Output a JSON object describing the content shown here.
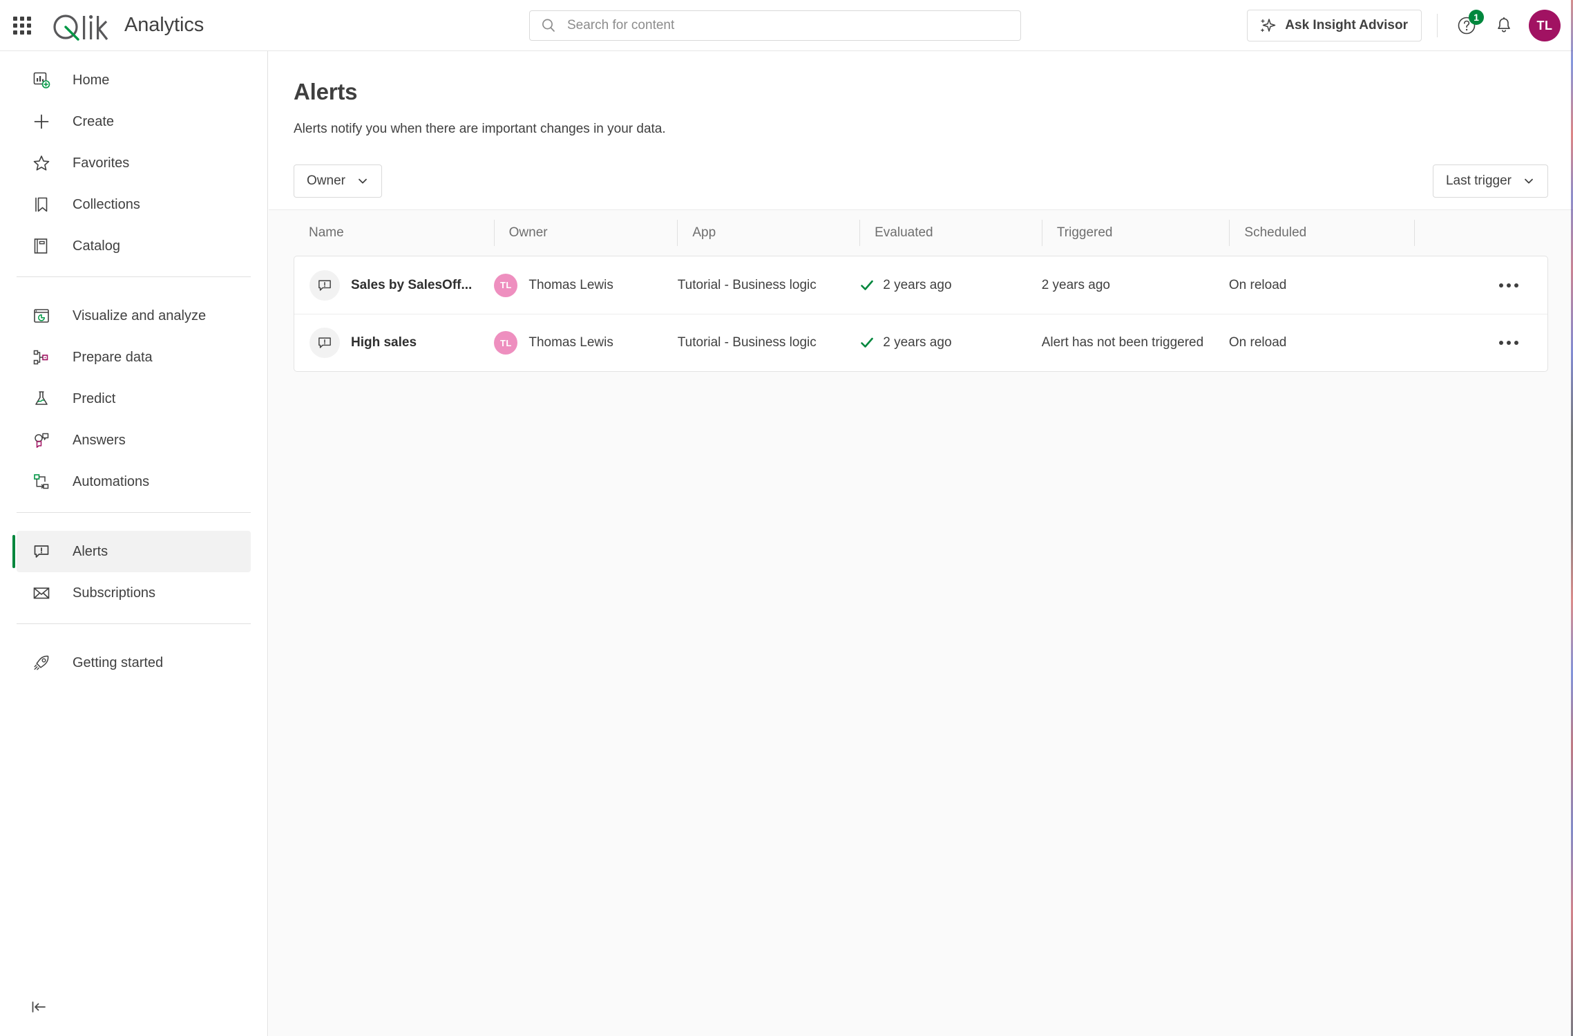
{
  "header": {
    "waffle_label": "app-launcher",
    "brand": "Qlik",
    "brand_title": "Analytics",
    "search_placeholder": "Search for content",
    "search_value": "",
    "insight_advisor": "Ask Insight Advisor",
    "help_badge": "1",
    "avatar_initials": "TL"
  },
  "sidebar": {
    "items": [
      {
        "label": "Home",
        "icon": "home-dashboard-icon",
        "selected": false
      },
      {
        "label": "Create",
        "icon": "plus-icon",
        "selected": false
      },
      {
        "label": "Favorites",
        "icon": "star-icon",
        "selected": false
      },
      {
        "label": "Collections",
        "icon": "bookmark-icon",
        "selected": false
      },
      {
        "label": "Catalog",
        "icon": "book-icon",
        "selected": false
      },
      {
        "label": "Visualize and analyze",
        "icon": "chart-window-icon",
        "selected": false
      },
      {
        "label": "Prepare data",
        "icon": "data-nodes-icon",
        "selected": false
      },
      {
        "label": "Predict",
        "icon": "flask-icon",
        "selected": false
      },
      {
        "label": "Answers",
        "icon": "chat-answers-icon",
        "selected": false
      },
      {
        "label": "Automations",
        "icon": "automation-flow-icon",
        "selected": false
      },
      {
        "label": "Alerts",
        "icon": "alert-bubble-icon",
        "selected": true
      },
      {
        "label": "Subscriptions",
        "icon": "envelope-icon",
        "selected": false
      },
      {
        "label": "Getting started",
        "icon": "rocket-icon",
        "selected": false
      }
    ],
    "collapse_label": "collapse-sidebar"
  },
  "page": {
    "title": "Alerts",
    "description": "Alerts notify you when there are important changes in your data.",
    "owner_filter": "Owner",
    "sort_label": "Last trigger"
  },
  "table": {
    "columns": [
      "Name",
      "Owner",
      "App",
      "Evaluated",
      "Triggered",
      "Scheduled"
    ],
    "rows": [
      {
        "name": "Sales by SalesOff...",
        "owner": "Thomas Lewis",
        "owner_initials": "TL",
        "app": "Tutorial - Business logic",
        "evaluated": "2 years ago",
        "evaluated_ok": true,
        "triggered": "2 years ago",
        "scheduled": "On reload"
      },
      {
        "name": "High sales",
        "owner": "Thomas Lewis",
        "owner_initials": "TL",
        "app": "Tutorial - Business logic",
        "evaluated": "2 years ago",
        "evaluated_ok": true,
        "triggered": "Alert has not been triggered",
        "scheduled": "On reload"
      }
    ]
  },
  "colors": {
    "accent_green": "#00873d",
    "avatar_top": "#a11262",
    "avatar_row": "#ee8fbf",
    "text": "#404040"
  }
}
